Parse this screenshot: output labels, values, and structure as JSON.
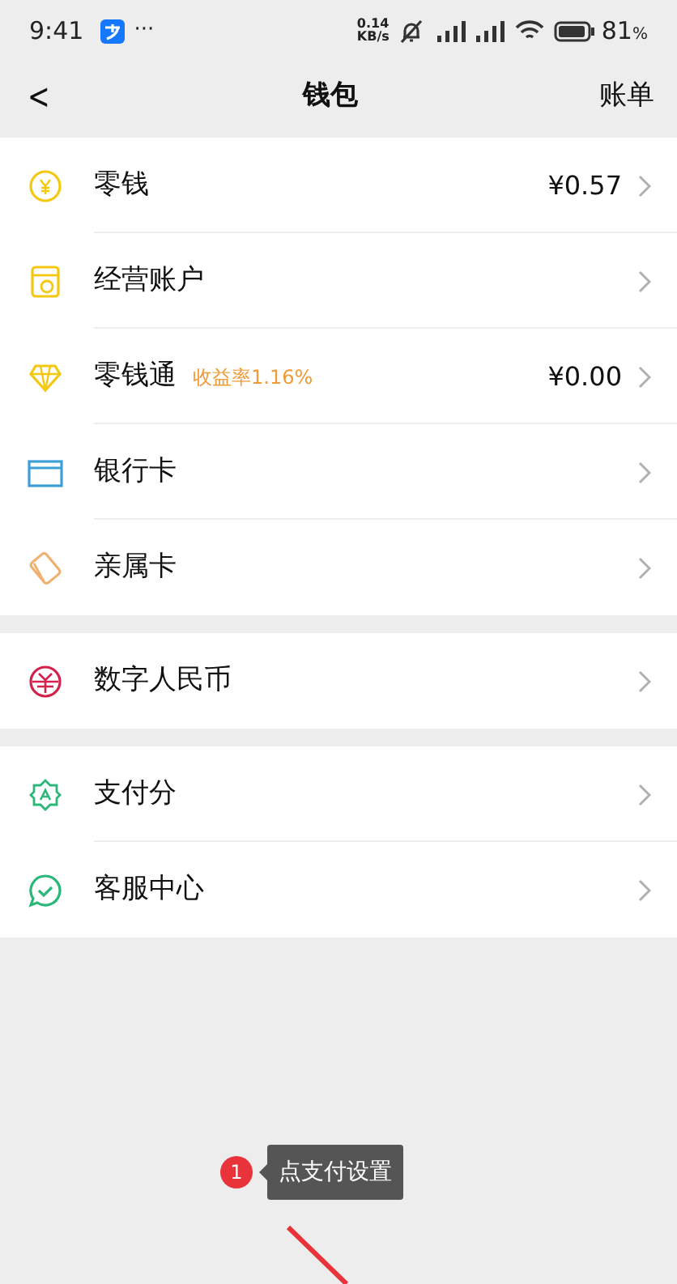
{
  "status_bar": {
    "time": "9:41",
    "more": "···",
    "net_speed": "0.14",
    "net_unit": "KB/s",
    "battery": "81",
    "battery_unit": "%"
  },
  "header": {
    "back": "<",
    "title": "钱包",
    "action": "账单"
  },
  "groups": [
    {
      "items": [
        {
          "kind": "coin",
          "label": "零钱",
          "value": "¥0.57"
        },
        {
          "kind": "shop",
          "label": "经营账户"
        },
        {
          "kind": "diamond",
          "label": "零钱通",
          "badge": "收益率1.16%",
          "value": "¥0.00"
        },
        {
          "kind": "card",
          "label": "银行卡"
        },
        {
          "kind": "family",
          "label": "亲属卡"
        }
      ]
    },
    {
      "items": [
        {
          "kind": "ecny",
          "label": "数字人民币"
        }
      ]
    },
    {
      "items": [
        {
          "kind": "score",
          "label": "支付分"
        },
        {
          "kind": "service",
          "label": "客服中心"
        }
      ]
    }
  ],
  "callout": {
    "step": "1",
    "text": "点支付设置"
  }
}
